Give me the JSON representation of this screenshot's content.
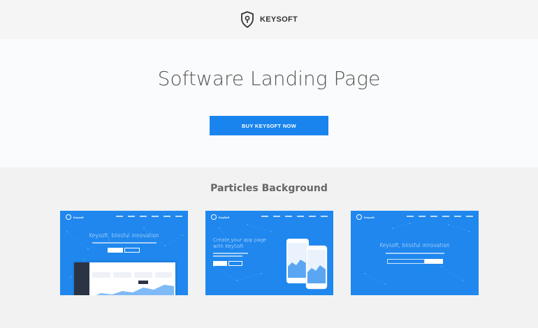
{
  "header": {
    "logo_text": "KEYSOFT",
    "logo_icon": "shield-key-icon"
  },
  "hero": {
    "title": "Software Landing Page",
    "cta_label": "BUY KEYSOFT NOW"
  },
  "demos": {
    "section_title": "Particles Background",
    "cards": [
      {
        "heading": "Keysoft, blissful innovation",
        "logo_text": "Keysoft"
      },
      {
        "heading_line1": "Create your app page",
        "heading_line2": "with KeySoft",
        "logo_text": "KeySoft"
      },
      {
        "heading": "Keysoft, blissful innovation",
        "logo_text": "Keysoft"
      }
    ]
  },
  "colors": {
    "accent": "#1a84ee",
    "card_blue": "#1f87ee",
    "header_bg": "#f5f5f5",
    "section_bg": "#f2f2f2"
  }
}
